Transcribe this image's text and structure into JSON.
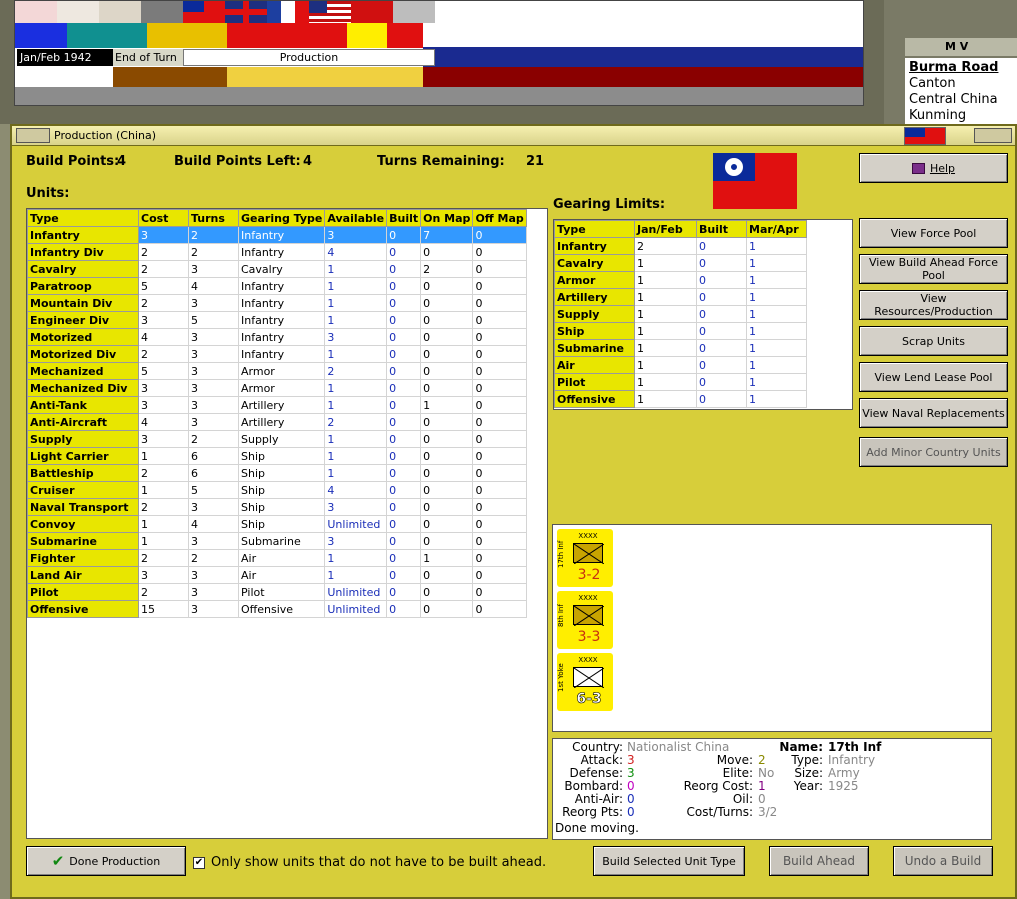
{
  "top": {
    "date": "Jan/Feb 1942",
    "end_turn": "End of Turn",
    "phase": "Production",
    "side_header": "M V",
    "side_list": [
      "Burma Road",
      "Canton",
      "Central China",
      "Kunming"
    ]
  },
  "window": {
    "title": "Production (China)"
  },
  "stats": {
    "build_points_label": "Build Points:",
    "build_points": "4",
    "build_points_left_label": "Build Points Left:",
    "build_points_left": "4",
    "turns_remaining_label": "Turns Remaining:",
    "turns_remaining": "21"
  },
  "units": {
    "title": "Units:",
    "columns": [
      "Type",
      "Cost",
      "Turns",
      "Gearing Type",
      "Available",
      "Built",
      "On Map",
      "Off Map"
    ],
    "rows": [
      [
        "Infantry",
        "3",
        "2",
        "Infantry",
        "3",
        "0",
        "7",
        "0"
      ],
      [
        "Infantry Div",
        "2",
        "2",
        "Infantry",
        "4",
        "0",
        "0",
        "0"
      ],
      [
        "Cavalry",
        "2",
        "3",
        "Cavalry",
        "1",
        "0",
        "2",
        "0"
      ],
      [
        "Paratroop",
        "5",
        "4",
        "Infantry",
        "1",
        "0",
        "0",
        "0"
      ],
      [
        "Mountain Div",
        "2",
        "3",
        "Infantry",
        "1",
        "0",
        "0",
        "0"
      ],
      [
        "Engineer Div",
        "3",
        "5",
        "Infantry",
        "1",
        "0",
        "0",
        "0"
      ],
      [
        "Motorized",
        "4",
        "3",
        "Infantry",
        "3",
        "0",
        "0",
        "0"
      ],
      [
        "Motorized Div",
        "2",
        "3",
        "Infantry",
        "1",
        "0",
        "0",
        "0"
      ],
      [
        "Mechanized",
        "5",
        "3",
        "Armor",
        "2",
        "0",
        "0",
        "0"
      ],
      [
        "Mechanized Div",
        "3",
        "3",
        "Armor",
        "1",
        "0",
        "0",
        "0"
      ],
      [
        "Anti-Tank",
        "3",
        "3",
        "Artillery",
        "1",
        "0",
        "1",
        "0"
      ],
      [
        "Anti-Aircraft",
        "4",
        "3",
        "Artillery",
        "2",
        "0",
        "0",
        "0"
      ],
      [
        "Supply",
        "3",
        "2",
        "Supply",
        "1",
        "0",
        "0",
        "0"
      ],
      [
        "Light Carrier",
        "1",
        "6",
        "Ship",
        "1",
        "0",
        "0",
        "0"
      ],
      [
        "Battleship",
        "2",
        "6",
        "Ship",
        "1",
        "0",
        "0",
        "0"
      ],
      [
        "Cruiser",
        "1",
        "5",
        "Ship",
        "4",
        "0",
        "0",
        "0"
      ],
      [
        "Naval Transport",
        "2",
        "3",
        "Ship",
        "3",
        "0",
        "0",
        "0"
      ],
      [
        "Convoy",
        "1",
        "4",
        "Ship",
        "Unlimited",
        "0",
        "0",
        "0"
      ],
      [
        "Submarine",
        "1",
        "3",
        "Submarine",
        "3",
        "0",
        "0",
        "0"
      ],
      [
        "Fighter",
        "2",
        "2",
        "Air",
        "1",
        "0",
        "1",
        "0"
      ],
      [
        "Land Air",
        "3",
        "3",
        "Air",
        "1",
        "0",
        "0",
        "0"
      ],
      [
        "Pilot",
        "2",
        "3",
        "Pilot",
        "Unlimited",
        "0",
        "0",
        "0"
      ],
      [
        "Offensive",
        "15",
        "3",
        "Offensive",
        "Unlimited",
        "0",
        "0",
        "0"
      ]
    ],
    "selected_index": 0
  },
  "gearing": {
    "title": "Gearing Limits:",
    "columns": [
      "Type",
      "Jan/Feb",
      "Built",
      "Mar/Apr"
    ],
    "rows": [
      [
        "Infantry",
        "2",
        "0",
        "1"
      ],
      [
        "Cavalry",
        "1",
        "0",
        "1"
      ],
      [
        "Armor",
        "1",
        "0",
        "1"
      ],
      [
        "Artillery",
        "1",
        "0",
        "1"
      ],
      [
        "Supply",
        "1",
        "0",
        "1"
      ],
      [
        "Ship",
        "1",
        "0",
        "1"
      ],
      [
        "Submarine",
        "1",
        "0",
        "1"
      ],
      [
        "Air",
        "1",
        "0",
        "1"
      ],
      [
        "Pilot",
        "1",
        "0",
        "1"
      ],
      [
        "Offensive",
        "1",
        "0",
        "1"
      ]
    ]
  },
  "buttons": {
    "help": "Help",
    "view_force_pool": "View Force Pool",
    "view_build_ahead": "View Build Ahead Force Pool",
    "view_resources": "View Resources/Production",
    "scrap_units": "Scrap Units",
    "view_lend_lease": "View Lend Lease Pool",
    "view_naval": "View Naval Replacements",
    "add_minor": "Add Minor Country Units",
    "done": "Done Production",
    "build_selected": "Build Selected Unit Type",
    "build_ahead": "Build Ahead",
    "undo_build": "Undo a Build"
  },
  "checkbox": {
    "label": "Only show units that do not have to be built ahead.",
    "checked": true
  },
  "unit_cards": [
    {
      "label": "17th Inf",
      "size": "XXXX",
      "strength": "3-2",
      "type": "infantry",
      "color": "#c83010"
    },
    {
      "label": "8th Inf",
      "size": "XXXX",
      "strength": "3-3",
      "type": "infantry",
      "color": "#c83010"
    },
    {
      "label": "1st Yoke",
      "size": "XXXX",
      "strength": "6-3",
      "type": "infantry",
      "color": "#ffffff"
    }
  ],
  "info": {
    "country_label": "Country:",
    "country": "Nationalist China",
    "attack_label": "Attack:",
    "attack": "3",
    "defense_label": "Defense:",
    "defense": "3",
    "bombard_label": "Bombard:",
    "bombard": "0",
    "antiair_label": "Anti-Air:",
    "antiair": "0",
    "reorg_pts_label": "Reorg Pts:",
    "reorg_pts": "0",
    "move_label": "Move:",
    "move": "2",
    "elite_label": "Elite:",
    "elite": "No",
    "reorg_cost_label": "Reorg Cost:",
    "reorg_cost": "1",
    "oil_label": "Oil:",
    "oil": "0",
    "cost_turns_label": "Cost/Turns:",
    "cost_turns": "3/2",
    "name_label": "Name:",
    "name": "17th Inf",
    "type_label": "Type:",
    "type": "Infantry",
    "size_label": "Size:",
    "size": "Army",
    "year_label": "Year:",
    "year": "1925",
    "status": "Done moving."
  },
  "colors": {
    "panel": "#d7ce3a",
    "header_cell": "#e8e600",
    "selection": "#3399ff",
    "value_blue": "#1a2eb8",
    "counter": "#ffee00",
    "china_red": "#e01010",
    "china_blue": "#0a2a9a"
  }
}
